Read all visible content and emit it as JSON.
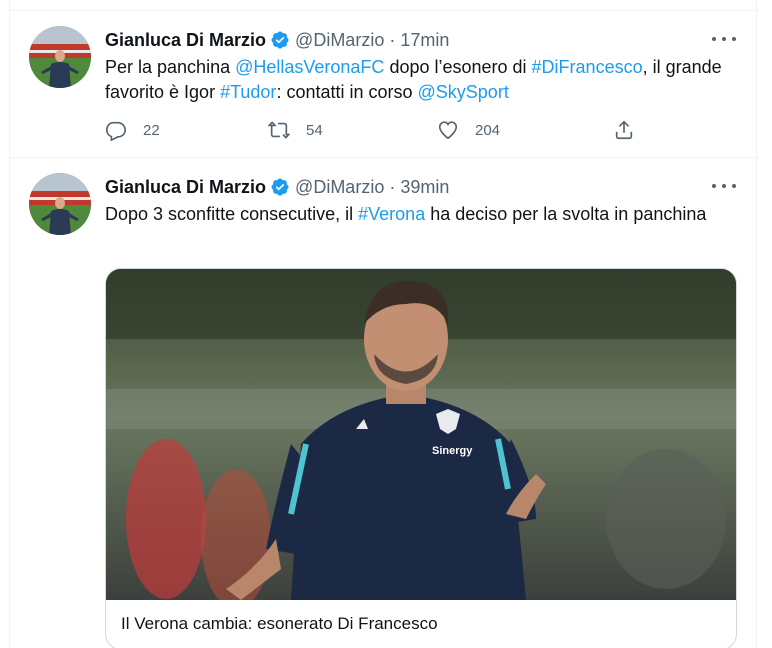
{
  "tweets": [
    {
      "author": {
        "name": "Gianluca Di Marzio",
        "handle": "@DiMarzio",
        "verified": true,
        "avatar_icon": "avatar-photo"
      },
      "separator": "·",
      "time": "17min",
      "text_parts": [
        {
          "t": "Per la panchina ",
          "link": false
        },
        {
          "t": "@HellasVeronaFC",
          "link": true
        },
        {
          "t": " dopo l’esonero di ",
          "link": false
        },
        {
          "t": "#DiFrancesco",
          "link": true
        },
        {
          "t": ", il grande favorito è Igor ",
          "link": false
        },
        {
          "t": "#Tudor",
          "link": true
        },
        {
          "t": ": contatti in corso  ",
          "link": false
        },
        {
          "t": "@SkySport",
          "link": true
        }
      ],
      "actions": {
        "reply": "22",
        "retweet": "54",
        "like": "204",
        "share": ""
      }
    },
    {
      "author": {
        "name": "Gianluca Di Marzio",
        "handle": "@DiMarzio",
        "verified": true,
        "avatar_icon": "avatar-photo"
      },
      "separator": "·",
      "time": "39min",
      "text_parts": [
        {
          "t": "Dopo 3 sconfitte consecutive, il ",
          "link": false
        },
        {
          "t": "#Verona",
          "link": true
        },
        {
          "t": " ha deciso per la svolta in panchina",
          "link": false
        }
      ],
      "card": {
        "title": "Il Verona cambia: esonerato Di Francesco",
        "media_icon": "photo-coach-gesturing",
        "jersey_text": "Sinergy"
      }
    }
  ],
  "colors": {
    "link": "#1d9bf0",
    "secondary_text": "#536471",
    "border": "#eff3f4",
    "verified": "#1d9bf0"
  }
}
